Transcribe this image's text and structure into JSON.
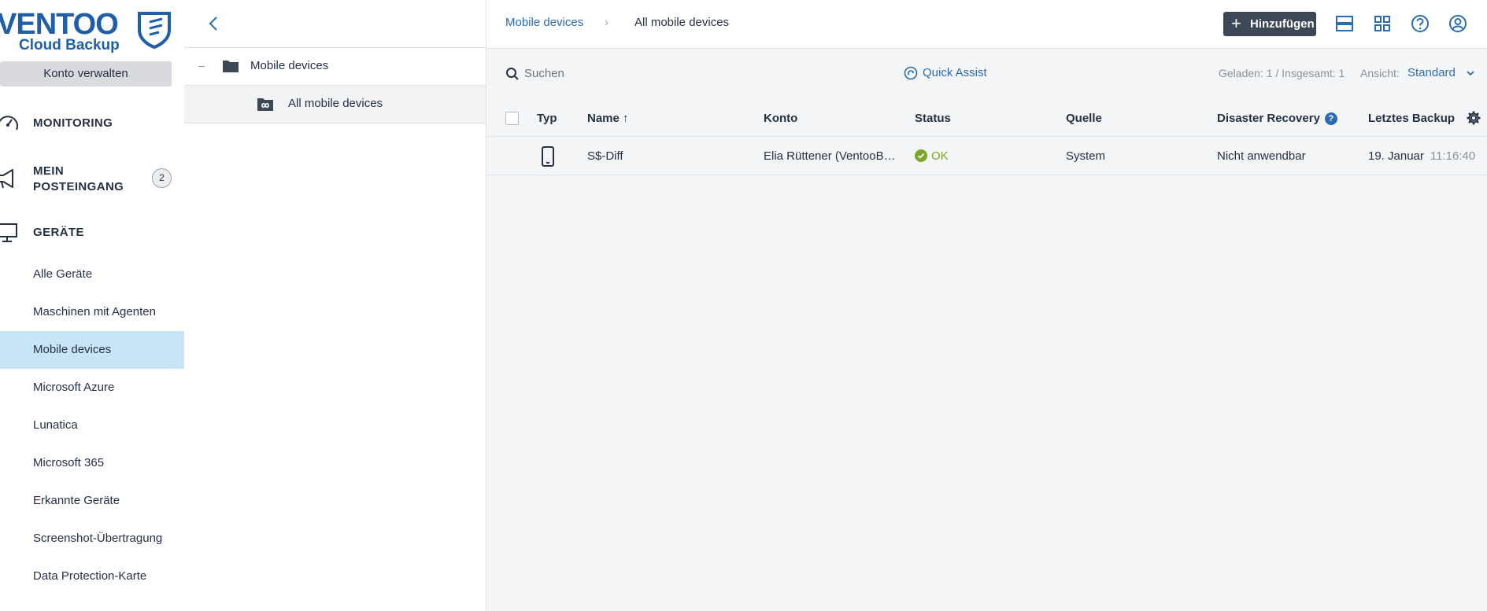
{
  "brand": {
    "line1": "VENTOO",
    "line2": "Cloud Backup",
    "color": "#1f5ea8"
  },
  "sidebar": {
    "manage_account": "Konto verwalten",
    "sections": [
      {
        "label": "MONITORING",
        "icon": "speedometer-icon"
      },
      {
        "label_line1": "MEIN",
        "label_line2": "POSTEINGANG",
        "icon": "megaphone-icon",
        "badge": "2"
      },
      {
        "label": "GERÄTE",
        "icon": "monitor-icon"
      }
    ],
    "items": [
      {
        "label": "Alle Geräte"
      },
      {
        "label": "Maschinen mit Agenten"
      },
      {
        "label": "Mobile devices",
        "active": true
      },
      {
        "label": "Microsoft Azure"
      },
      {
        "label": "Lunatica"
      },
      {
        "label": "Microsoft 365"
      },
      {
        "label": "Erkannte Geräte"
      },
      {
        "label": "Screenshot-Übertragung"
      },
      {
        "label": "Data Protection-Karte"
      }
    ]
  },
  "tree": {
    "root": {
      "toggle": "–",
      "label": "Mobile devices"
    },
    "child": {
      "label": "All mobile devices"
    }
  },
  "header": {
    "breadcrumb": [
      "Mobile devices",
      "All mobile devices"
    ],
    "breadcrumb_separator": "›",
    "add_button": "Hinzufügen",
    "add_symbol": "+"
  },
  "toolbar": {
    "search_placeholder": "Suchen",
    "quick_assist": "Quick Assist",
    "loaded": "Geladen: 1 / Insgesamt: 1",
    "view_label": "Ansicht:",
    "view_value": "Standard"
  },
  "table": {
    "columns": {
      "type": "Typ",
      "name": "Name ↑",
      "account": "Konto",
      "status": "Status",
      "source": "Quelle",
      "dr": "Disaster Recovery",
      "dr_help": "?",
      "last_backup": "Letztes Backup"
    },
    "rows": [
      {
        "type_icon": "phone-icon",
        "name": "S$-Diff",
        "account": "Elia Rüttener (VentooB…",
        "status": "OK",
        "source": "System",
        "dr": "Nicht anwendbar",
        "last_backup_date": "19. Januar",
        "last_backup_time": "11:16:40"
      }
    ]
  },
  "colors": {
    "link": "#2a6cb0",
    "active_nav": "#c8e5f8",
    "ok": "#7aa62a",
    "dark_button": "#3c4856"
  }
}
